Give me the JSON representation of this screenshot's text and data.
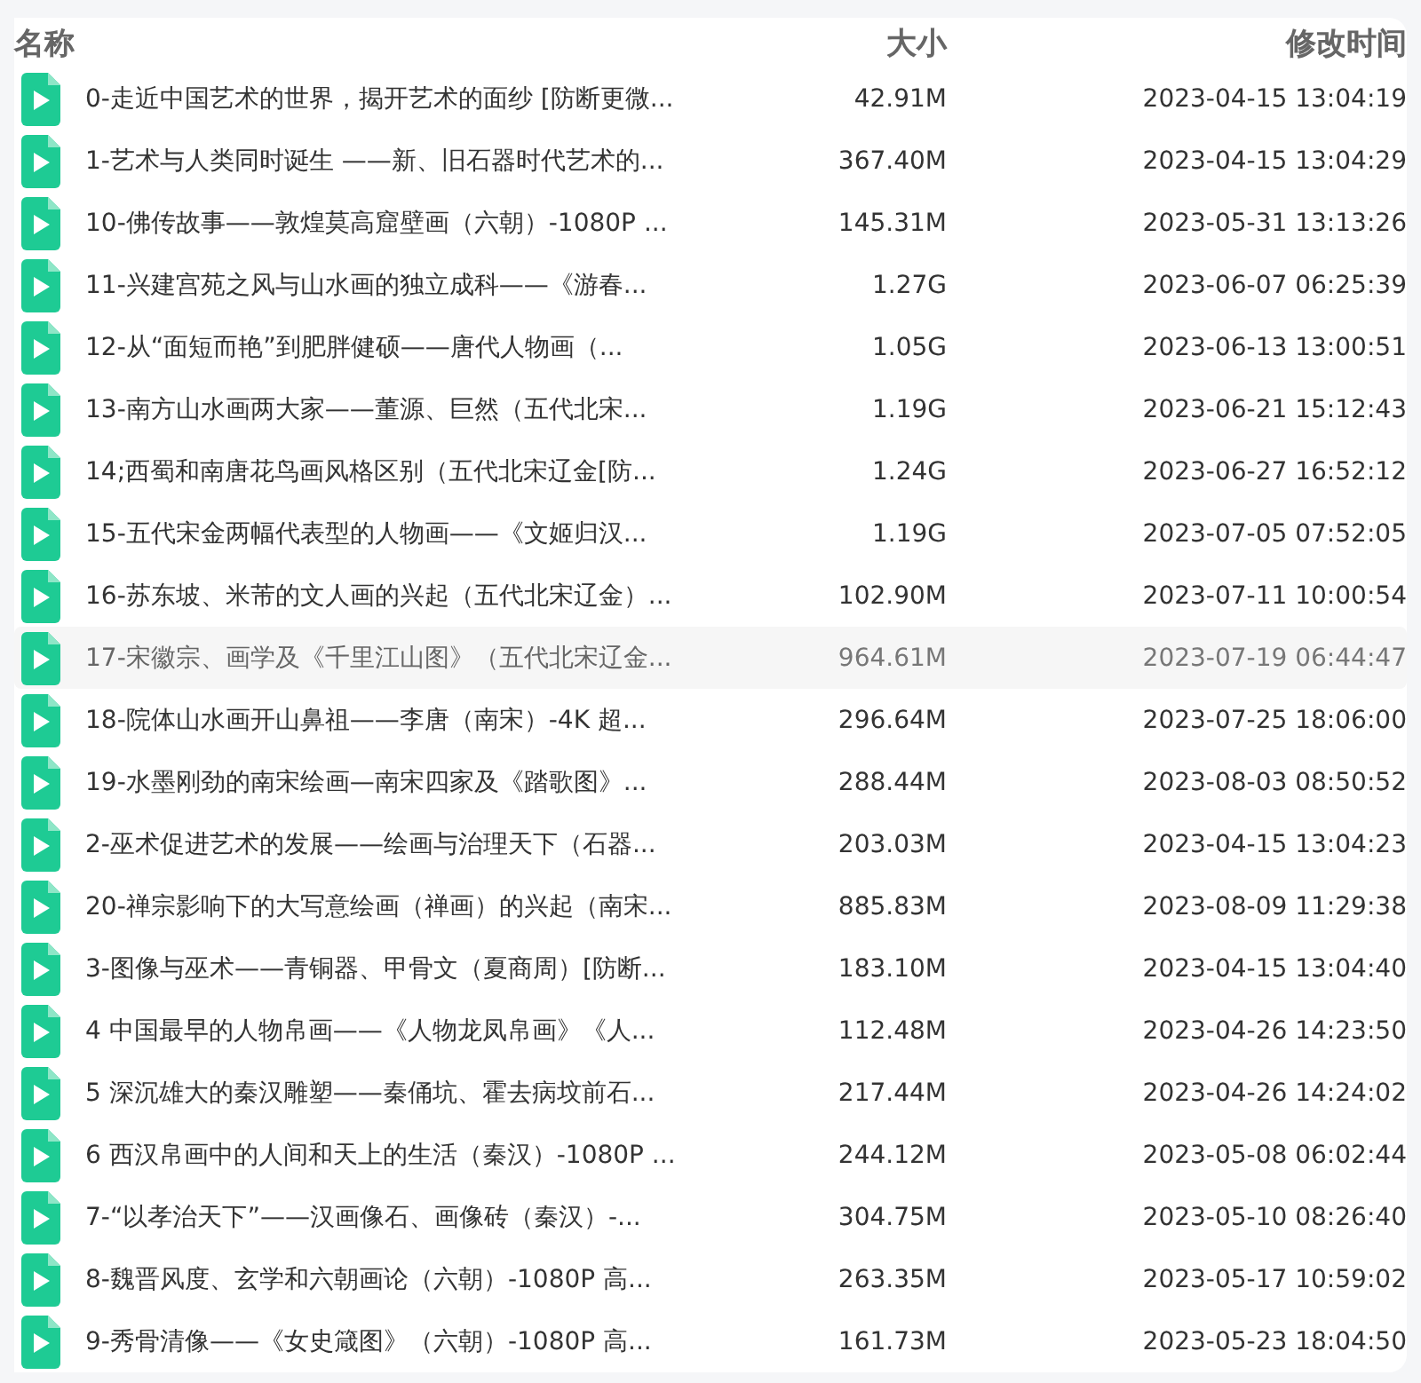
{
  "table": {
    "columns": [
      "名称",
      "大小",
      "修改时间"
    ],
    "rows": [
      {
        "name": "0-走近中国艺术的世界，揭开艺术的面纱 [防断更微...",
        "size": "42.91M",
        "modified": "2023-04-15 13:04:19",
        "selected": false
      },
      {
        "name": "1-艺术与人类同时诞生 ——新、旧石器时代艺术的...",
        "size": "367.40M",
        "modified": "2023-04-15 13:04:29",
        "selected": false
      },
      {
        "name": "10-佛传故事——敦煌莫高窟壁画（六朝）-1080P ...",
        "size": "145.31M",
        "modified": "2023-05-31 13:13:26",
        "selected": false
      },
      {
        "name": "11-兴建宫苑之风与山水画的独立成科——《游春...",
        "size": "1.27G",
        "modified": "2023-06-07 06:25:39",
        "selected": false
      },
      {
        "name": "12-从“面短而艳”到肥胖健硕——唐代人物画（...",
        "size": "1.05G",
        "modified": "2023-06-13 13:00:51",
        "selected": false
      },
      {
        "name": "13-南方山水画两大家——董源、巨然（五代北宋...",
        "size": "1.19G",
        "modified": "2023-06-21 15:12:43",
        "selected": false
      },
      {
        "name": "14;西蜀和南唐花鸟画风格区别（五代北宋辽金[防...",
        "size": "1.24G",
        "modified": "2023-06-27 16:52:12",
        "selected": false
      },
      {
        "name": "15-五代宋金两幅代表型的人物画——《文姬归汉...",
        "size": "1.19G",
        "modified": "2023-07-05 07:52:05",
        "selected": false
      },
      {
        "name": "16-苏东坡、米芾的文人画的兴起（五代北宋辽金）...",
        "size": "102.90M",
        "modified": "2023-07-11 10:00:54",
        "selected": false
      },
      {
        "name": "17-宋徽宗、画学及《千里江山图》（五代北宋辽金...",
        "size": "964.61M",
        "modified": "2023-07-19 06:44:47",
        "selected": true
      },
      {
        "name": "18-院体山水画开山鼻祖——李唐（南宋）-4K 超...",
        "size": "296.64M",
        "modified": "2023-07-25 18:06:00",
        "selected": false
      },
      {
        "name": "19-水墨刚劲的南宋绘画—南宋四家及《踏歌图》...",
        "size": "288.44M",
        "modified": "2023-08-03 08:50:52",
        "selected": false
      },
      {
        "name": "2-巫术促进艺术的发展——绘画与治理天下（石器...",
        "size": "203.03M",
        "modified": "2023-04-15 13:04:23",
        "selected": false
      },
      {
        "name": "20-禅宗影响下的大写意绘画（禅画）的兴起（南宋...",
        "size": "885.83M",
        "modified": "2023-08-09 11:29:38",
        "selected": false
      },
      {
        "name": "3-图像与巫术——青铜器、甲骨文（夏商周）[防断...",
        "size": "183.10M",
        "modified": "2023-04-15 13:04:40",
        "selected": false
      },
      {
        "name": "4 中国最早的人物帛画——《人物龙凤帛画》《人...",
        "size": "112.48M",
        "modified": "2023-04-26 14:23:50",
        "selected": false
      },
      {
        "name": "5 深沉雄大的秦汉雕塑——秦俑坑、霍去病坟前石...",
        "size": "217.44M",
        "modified": "2023-04-26 14:24:02",
        "selected": false
      },
      {
        "name": "6 西汉帛画中的人间和天上的生活（秦汉）-1080P ...",
        "size": "244.12M",
        "modified": "2023-05-08 06:02:44",
        "selected": false
      },
      {
        "name": "7-“以孝治天下”——汉画像石、画像砖（秦汉）-...",
        "size": "304.75M",
        "modified": "2023-05-10 08:26:40",
        "selected": false
      },
      {
        "name": "8-魏晋风度、玄学和六朝画论（六朝）-1080P 高...",
        "size": "263.35M",
        "modified": "2023-05-17 10:59:02",
        "selected": false
      },
      {
        "name": "9-秀骨清像——《女史箴图》（六朝）-1080P 高...",
        "size": "161.73M",
        "modified": "2023-05-23 18:04:50",
        "selected": false
      }
    ]
  }
}
